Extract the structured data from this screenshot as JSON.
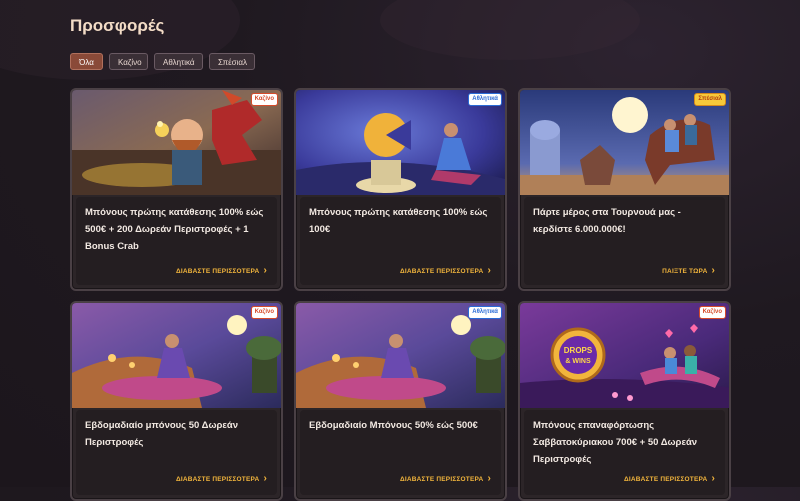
{
  "page": {
    "title": "Προσφορές"
  },
  "filters": [
    {
      "label": "Όλα",
      "active": true
    },
    {
      "label": "Καζίνο",
      "active": false
    },
    {
      "label": "Αθλητικά",
      "active": false
    },
    {
      "label": "Σπέσιαλ",
      "active": false
    }
  ],
  "cards": [
    {
      "badge": "Καζίνο",
      "text": "Μπόνους πρώτης κατάθεσης 100% εώς 500€ + 200 Δωρεάν Περιστροφές + 1 Bonus Crab",
      "link": "ΔΙΑΒΑΣΤΕ ΠΕΡΙΣΣΟΤΕΡΑ"
    },
    {
      "badge": "Αθλητικά",
      "text": "Μπόνους πρώτης κατάθεσης 100% εώς 100€",
      "link": "ΔΙΑΒΑΣΤΕ ΠΕΡΙΣΣΟΤΕΡΑ"
    },
    {
      "badge": "Σπέσιαλ",
      "text": "Πάρτε μέρος στα Τουρνουά μας - κερδίστε 6.000.000€!",
      "link": "ΠΑΙΞΤΕ ΤΩΡΑ"
    },
    {
      "badge": "Καζίνο",
      "text": "Εβδομαδιαίο μπόνους 50 Δωρεάν Περιστροφές",
      "link": "ΔΙΑΒΑΣΤΕ ΠΕΡΙΣΣΟΤΕΡΑ"
    },
    {
      "badge": "Αθλητικά",
      "text": "Εβδομαδιαίο Μπόνους 50% εώς 500€",
      "link": "ΔΙΑΒΑΣΤΕ ΠΕΡΙΣΣΟΤΕΡΑ"
    },
    {
      "badge": "Καζίνο",
      "text": "Μπόνους επαναφόρτωσης Σαββατοκύριακου 700€ + 50 Δωρεάν Περιστροφές",
      "link": "ΔΙΑΒΑΣΤΕ ΠΕΡΙΣΣΟΤΕΡΑ"
    }
  ],
  "drops_logo": {
    "line1": "DROPS",
    "line2": "& WINS"
  }
}
